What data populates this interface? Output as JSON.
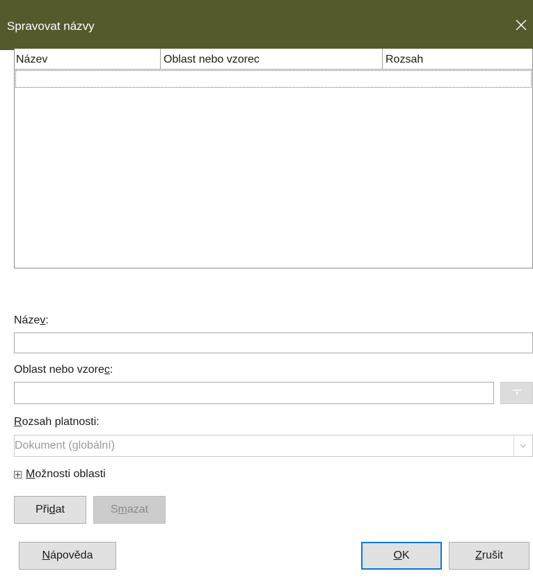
{
  "window": {
    "title": "Spravovat názvy",
    "close_icon": "close-icon"
  },
  "names_list": {
    "columns": [
      "Název",
      "Oblast nebo vzorec",
      "Rozsah"
    ],
    "rows": []
  },
  "form": {
    "name_label_pre": "Náze",
    "name_label_ul": "v",
    "name_label_post": ":",
    "name_value": "",
    "range_label_pre": "Oblast nebo vzore",
    "range_label_ul": "c",
    "range_label_post": ":",
    "range_value": "",
    "shrink_icon": "shrink-icon",
    "scope_label_ul": "R",
    "scope_label_post": "ozsah platnosti:",
    "scope_value": "Dokument (globální)",
    "scope_dropdown_icon": "chevron-down-icon"
  },
  "range_options": {
    "label_ul": "M",
    "label_post": "ožnosti oblasti",
    "expander_icon": "plus-box-icon"
  },
  "buttons": {
    "add_pre": "Při",
    "add_ul": "d",
    "add_post": "at",
    "delete_pre": "S",
    "delete_ul": "m",
    "delete_post": "azat",
    "help_ul": "N",
    "help_post": "ápověda",
    "ok_ul": "O",
    "ok_post": "K",
    "cancel_ul": "Z",
    "cancel_post": "rušit"
  },
  "colors": {
    "titlebar_bg": "#545a2c",
    "default_button_border": "#0a78d4"
  }
}
